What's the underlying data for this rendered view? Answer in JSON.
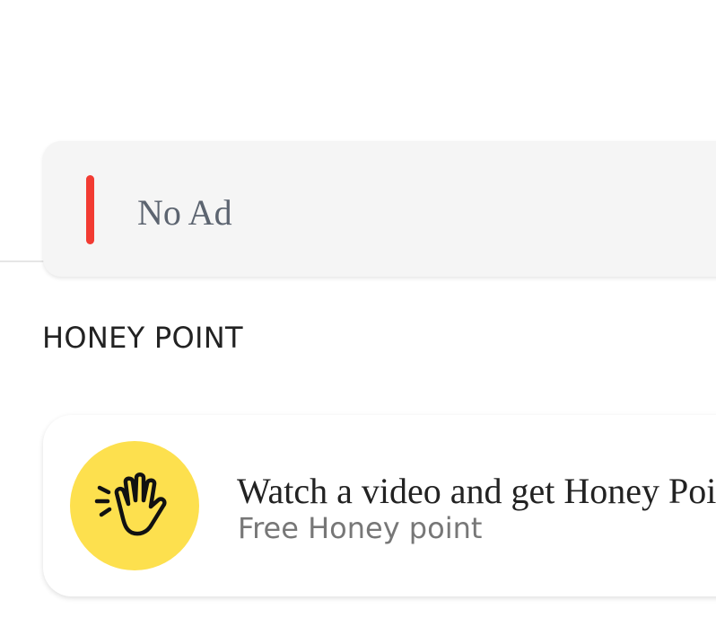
{
  "no_ad": {
    "label": "No Ad",
    "accent_color": "#f23b32"
  },
  "honey_point": {
    "section_title": "HONEY POINT",
    "video_reward": {
      "title": "Watch a video and get Honey Point",
      "subtitle": "Free Honey point",
      "icon": "waving-hand-icon",
      "icon_background": "#fde04e"
    }
  }
}
